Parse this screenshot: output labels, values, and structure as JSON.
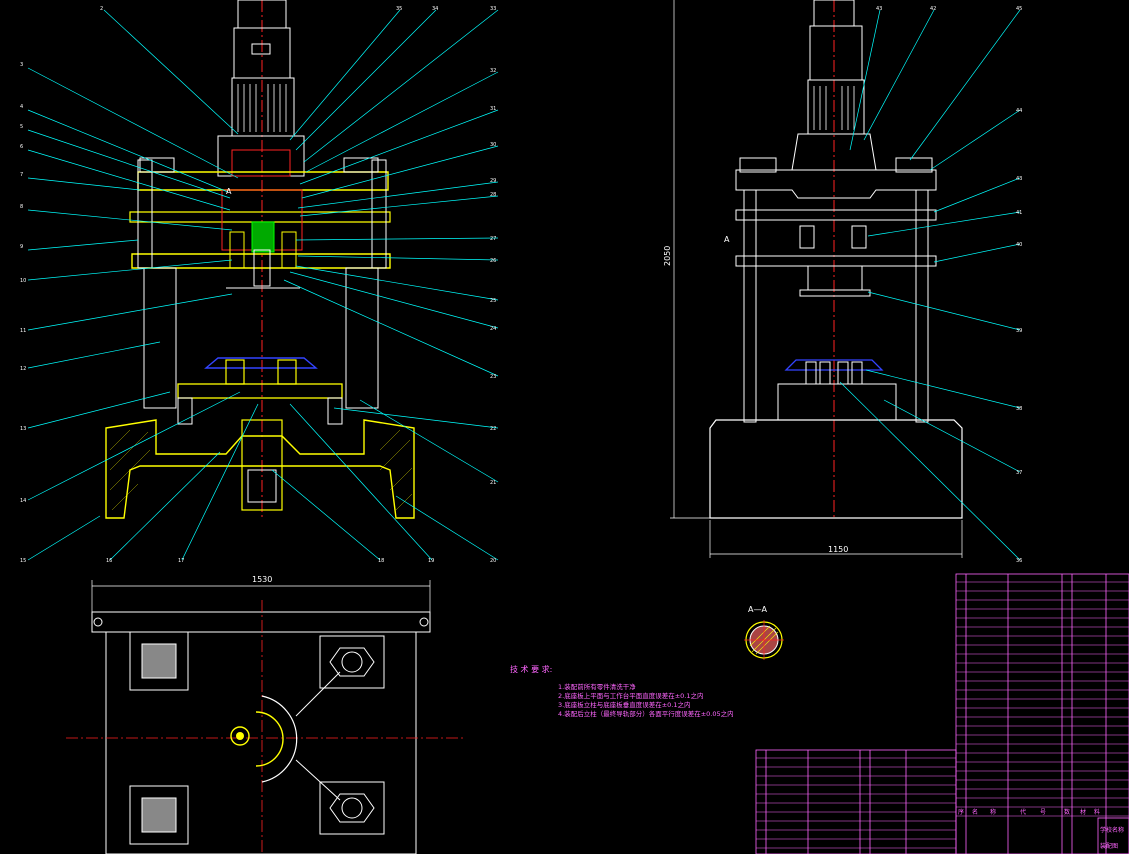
{
  "drawing": {
    "dimensions": {
      "front_height": "2050",
      "side_width": "1150",
      "plan_width": "1530"
    },
    "section_marks": {
      "left": "A",
      "right": "A",
      "section_title": "A—A"
    },
    "tech_notes": {
      "title": "技 术 要 求:",
      "lines": [
        "1.装配前所有零件清洗干净",
        "2.底座板上平面与工作台平面直度误差在±0.1之内",
        "3.底座板立柱与底座板垂直度误差在±0.1之内",
        "4.装配后立柱（最终导轨部分）各面平行度误差在±0.05之内"
      ]
    },
    "title_block": {
      "header_row": [
        "序",
        "名",
        "称",
        "代",
        "号",
        "数",
        "材",
        "料"
      ],
      "school": "学校名称",
      "drawing_no": "装配图"
    }
  },
  "colors": {
    "outline": "#ffffff",
    "leader": "#00ffff",
    "center": "#ff2222",
    "part": "#ffff00",
    "hidden": "#00ff00",
    "table": "#ff66ff",
    "blue": "#3344ff"
  }
}
